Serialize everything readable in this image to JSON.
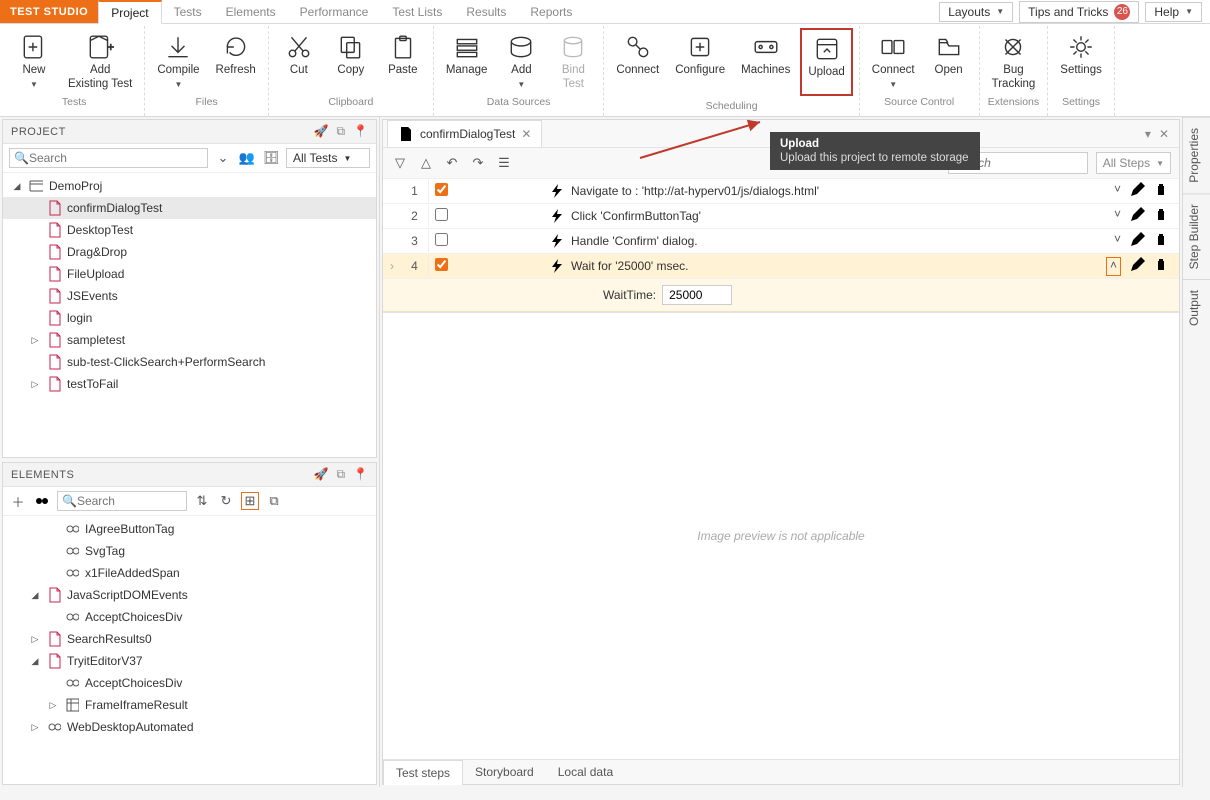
{
  "brand": "TEST STUDIO",
  "menu_tabs": [
    "Project",
    "Tests",
    "Elements",
    "Performance",
    "Test Lists",
    "Results",
    "Reports"
  ],
  "active_menu_tab": 0,
  "menubar_right": {
    "layouts": "Layouts",
    "tips": "Tips and Tricks",
    "tips_badge": "26",
    "help": "Help"
  },
  "ribbon": {
    "groups": [
      {
        "label": "Tests",
        "items": [
          {
            "name": "New",
            "dropdown": true,
            "icon": "new"
          },
          {
            "name": "Add Existing Test",
            "icon": "add-existing"
          }
        ]
      },
      {
        "label": "Files",
        "items": [
          {
            "name": "Compile",
            "dropdown": true,
            "icon": "compile"
          },
          {
            "name": "Refresh",
            "icon": "refresh"
          }
        ]
      },
      {
        "label": "Clipboard",
        "items": [
          {
            "name": "Cut",
            "icon": "cut"
          },
          {
            "name": "Copy",
            "icon": "copy"
          },
          {
            "name": "Paste",
            "icon": "paste"
          }
        ]
      },
      {
        "label": "Data Sources",
        "items": [
          {
            "name": "Manage",
            "icon": "manage"
          },
          {
            "name": "Add",
            "dropdown": true,
            "icon": "add-ds"
          },
          {
            "name": "Bind Test",
            "icon": "bind",
            "disabled": true
          }
        ]
      },
      {
        "label": "Scheduling",
        "items": [
          {
            "name": "Connect",
            "icon": "connect"
          },
          {
            "name": "Configure",
            "icon": "configure"
          },
          {
            "name": "Machines",
            "icon": "machines"
          },
          {
            "name": "Upload",
            "icon": "upload",
            "highlight": true
          }
        ]
      },
      {
        "label": "Source Control",
        "items": [
          {
            "name": "Connect",
            "dropdown": true,
            "icon": "sc-connect"
          },
          {
            "name": "Open",
            "icon": "sc-open"
          }
        ]
      },
      {
        "label": "Extensions",
        "items": [
          {
            "name": "Bug Tracking",
            "icon": "bug"
          }
        ]
      },
      {
        "label": "Settings",
        "items": [
          {
            "name": "Settings",
            "icon": "settings"
          }
        ]
      }
    ]
  },
  "tooltip": {
    "title": "Upload",
    "body": "Upload this project to remote storage"
  },
  "project_panel": {
    "title": "PROJECT",
    "search_placeholder": "Search",
    "filter": "All Tests",
    "tree": [
      {
        "level": 0,
        "expand": "open",
        "icon": "project",
        "label": "DemoProj"
      },
      {
        "level": 1,
        "icon": "file",
        "label": "confirmDialogTest",
        "selected": true
      },
      {
        "level": 1,
        "icon": "file",
        "label": "DesktopTest"
      },
      {
        "level": 1,
        "icon": "file",
        "label": "Drag&Drop"
      },
      {
        "level": 1,
        "icon": "file",
        "label": "FileUpload"
      },
      {
        "level": 1,
        "icon": "file",
        "label": "JSEvents"
      },
      {
        "level": 1,
        "icon": "file",
        "label": "login"
      },
      {
        "level": 1,
        "expand": "closed",
        "icon": "file",
        "label": "sampletest"
      },
      {
        "level": 1,
        "icon": "file",
        "label": "sub-test-ClickSearch+PerformSearch"
      },
      {
        "level": 1,
        "expand": "closed",
        "icon": "file",
        "label": "testToFail"
      }
    ]
  },
  "elements_panel": {
    "title": "ELEMENTS",
    "search_placeholder": "Search",
    "tree": [
      {
        "level": 2,
        "icon": "link",
        "label": "IAgreeButtonTag"
      },
      {
        "level": 2,
        "icon": "link",
        "label": "SvgTag"
      },
      {
        "level": 2,
        "icon": "link",
        "label": "x1FileAddedSpan"
      },
      {
        "level": 1,
        "expand": "open",
        "icon": "file",
        "label": "JavaScriptDOMEvents"
      },
      {
        "level": 2,
        "icon": "link",
        "label": "AcceptChoicesDiv"
      },
      {
        "level": 1,
        "expand": "closed",
        "icon": "file",
        "label": "SearchResults0"
      },
      {
        "level": 1,
        "expand": "open",
        "icon": "file",
        "label": "TryitEditorV37"
      },
      {
        "level": 2,
        "icon": "link",
        "label": "AcceptChoicesDiv"
      },
      {
        "level": 2,
        "expand": "closed",
        "icon": "frame",
        "label": "FrameIframeResult"
      },
      {
        "level": 1,
        "expand": "closed",
        "icon": "link",
        "label": "WebDesktopAutomated"
      }
    ]
  },
  "editor": {
    "tab_label": "confirmDialogTest",
    "search_placeholder": "Search",
    "filter": "All Steps",
    "steps": [
      {
        "n": 1,
        "checked": true,
        "text": "Navigate to : 'http://at-hyperv01/js/dialogs.html'"
      },
      {
        "n": 2,
        "checked": false,
        "text": "Click 'ConfirmButtonTag'"
      },
      {
        "n": 3,
        "checked": false,
        "text": "Handle 'Confirm' dialog."
      },
      {
        "n": 4,
        "checked": true,
        "text": "Wait for '25000' msec.",
        "selected": true
      }
    ],
    "detail_label": "WaitTime:",
    "detail_value": "25000",
    "preview_text": "Image preview is not applicable",
    "bottom_tabs": [
      "Test steps",
      "Storyboard",
      "Local data"
    ],
    "active_bottom_tab": 0
  },
  "side_tabs": [
    "Properties",
    "Step Builder",
    "Output"
  ]
}
